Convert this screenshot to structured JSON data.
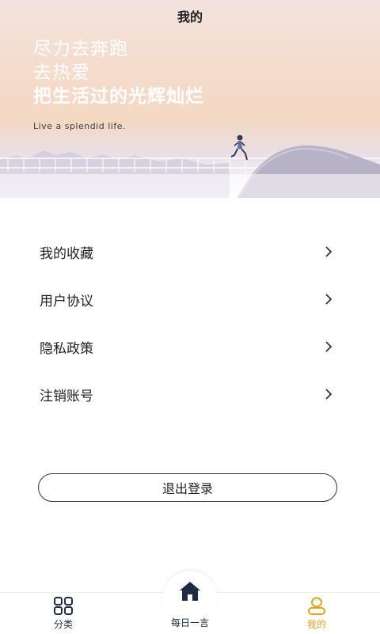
{
  "header": {
    "title": "我的"
  },
  "hero": {
    "line1": "尽力去奔跑",
    "line2": "去热爱",
    "line3": "把生活过的光辉灿烂",
    "tagline": "Live a splendid life."
  },
  "menu": {
    "items": [
      {
        "label": "我的收藏",
        "chevron": ">"
      },
      {
        "label": "用户协议",
        "chevron": ">"
      },
      {
        "label": "隐私政策",
        "chevron": ">"
      },
      {
        "label": "注销账号",
        "chevron": ">"
      }
    ]
  },
  "logout": {
    "label": "退出登录"
  },
  "tabbar": {
    "tabs": [
      {
        "label": "分类",
        "icon": "grid-icon"
      },
      {
        "label": "每日一言",
        "icon": "home-icon"
      },
      {
        "label": "我的",
        "icon": "user-icon",
        "active": true
      }
    ]
  },
  "colors": {
    "accent": "#e7a11f",
    "nav_dark": "#1f2a44"
  }
}
